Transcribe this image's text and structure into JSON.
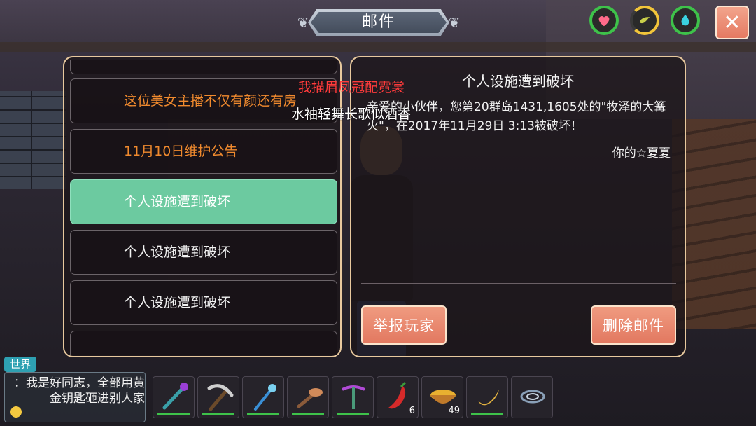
{
  "header": {
    "title": "邮件",
    "status_icons": [
      "heart-icon",
      "hunger-icon",
      "water-icon"
    ],
    "close_label": "✕"
  },
  "mail_list": {
    "items": [
      {
        "label": "这位美女主播不仅有颜还有房",
        "state": "unread"
      },
      {
        "label": "11月10日维护公告",
        "state": "unread"
      },
      {
        "label": "个人设施遭到破坏",
        "state": "selected"
      },
      {
        "label": "个人设施遭到破坏",
        "state": "read"
      },
      {
        "label": "个人设施遭到破坏",
        "state": "read"
      }
    ]
  },
  "detail": {
    "title": "个人设施遭到破坏",
    "body": "亲爱的小伙伴，您第20群岛1431,1605处的\"牧泽的大篝火\"，在2017年11月29日 3:13被破坏！",
    "signature": "你的☆夏夏",
    "report_label": "举报玩家",
    "delete_label": "删除邮件"
  },
  "danmaku": {
    "line1": "我描眉凤冠配霓裳",
    "line2": "水袖轻舞长歌似酒香"
  },
  "chat": {
    "channel": "世界",
    "message": "：我是好同志，全部用黄金钥匙砸进别人家"
  },
  "hotbar": {
    "slots": [
      {
        "icon": "staff-icon",
        "count": ""
      },
      {
        "icon": "pickaxe-icon",
        "count": ""
      },
      {
        "icon": "wand-icon",
        "count": ""
      },
      {
        "icon": "shovel-icon",
        "count": ""
      },
      {
        "icon": "crossbow-icon",
        "count": ""
      },
      {
        "icon": "chili-pepper-icon",
        "count": "6"
      },
      {
        "icon": "soup-bowl-icon",
        "count": "49"
      },
      {
        "icon": "banana-icon",
        "count": ""
      },
      {
        "icon": "vortex-icon",
        "count": ""
      }
    ]
  },
  "colors": {
    "accent_green": "#6ccaa0",
    "unread_orange": "#f08a2e",
    "button_salmon": "#e27860",
    "panel_border": "#e8c99e"
  }
}
